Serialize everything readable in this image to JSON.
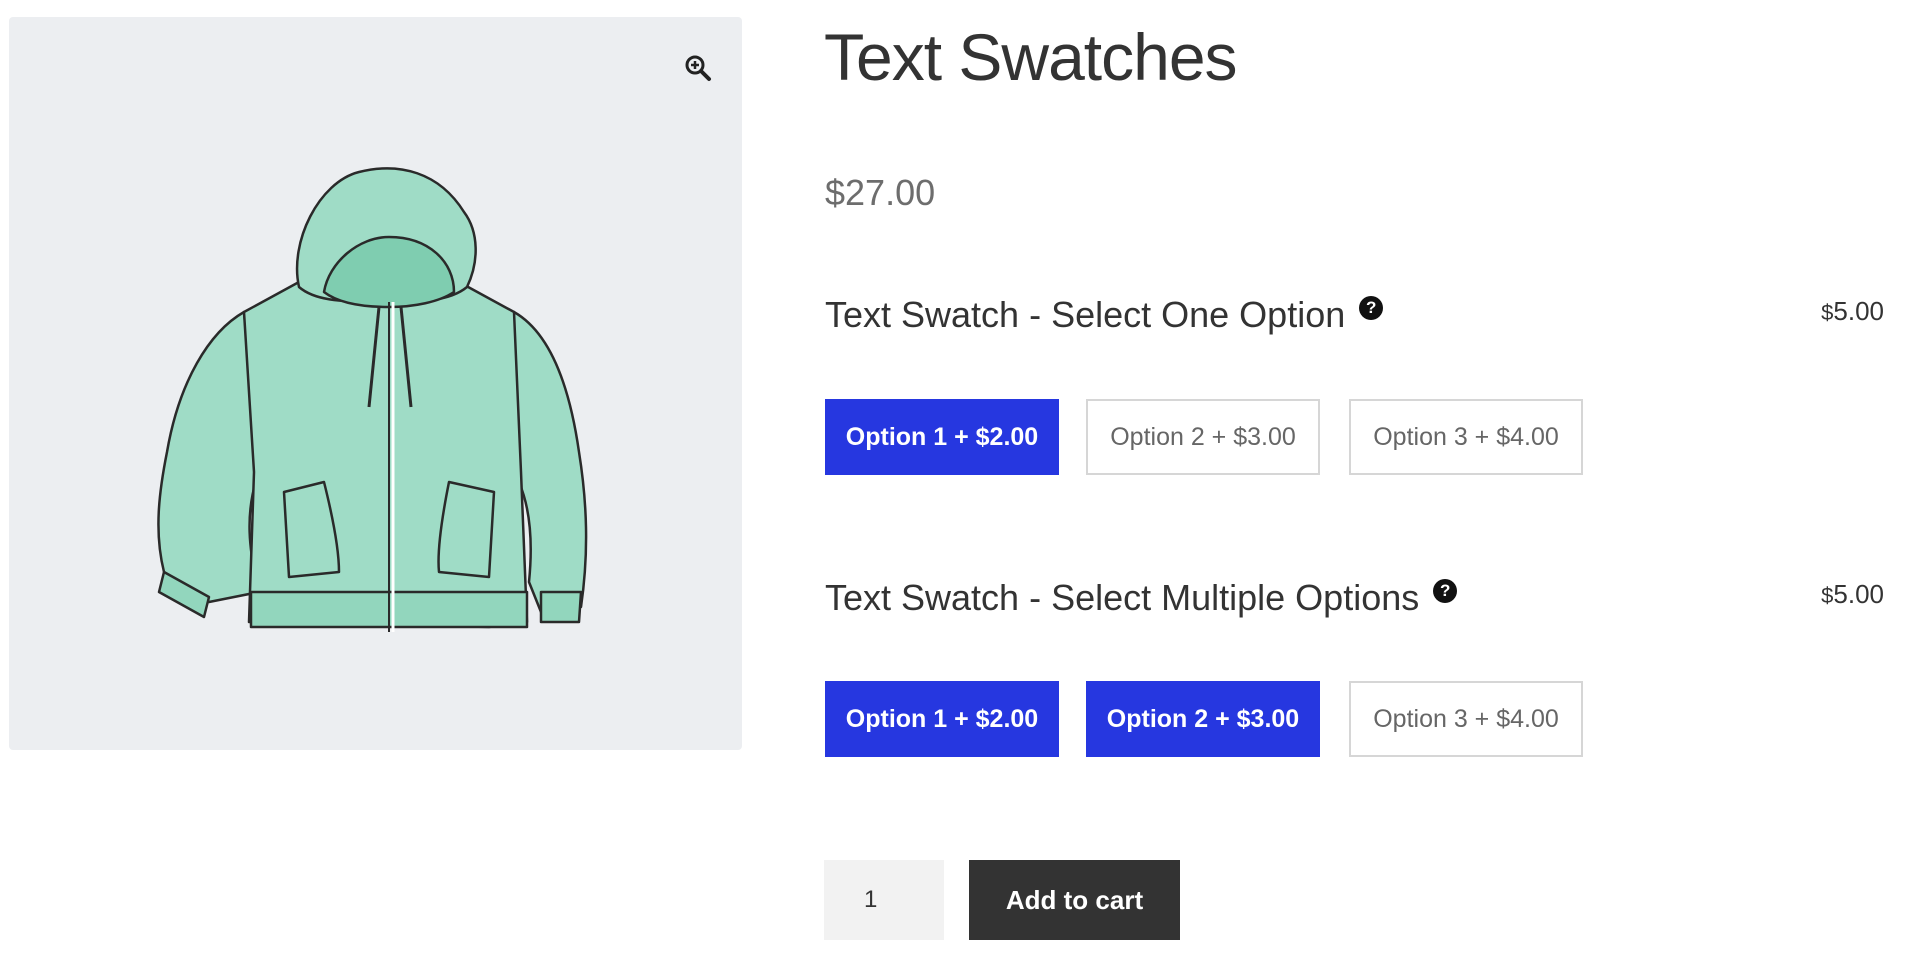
{
  "gallery": {
    "zoom_icon": "zoom-in-icon",
    "image_icon": "hoodie-product-image",
    "colors": {
      "hoodie_fill": "#9fdcc6",
      "background": "#eceef1"
    }
  },
  "product": {
    "title": "Text Swatches",
    "price": "$27.00"
  },
  "groups": [
    {
      "label": "Text Swatch - Select One Option",
      "help_icon": "?",
      "price_currency": "$",
      "price_value": "5.00",
      "options": [
        {
          "label": "Option 1 + $2.00",
          "selected": true
        },
        {
          "label": "Option 2 + $3.00",
          "selected": false
        },
        {
          "label": "Option 3 + $4.00",
          "selected": false
        }
      ]
    },
    {
      "label": "Text Swatch - Select Multiple Options",
      "help_icon": "?",
      "price_currency": "$",
      "price_value": "5.00",
      "options": [
        {
          "label": "Option 1 + $2.00",
          "selected": true
        },
        {
          "label": "Option 2 + $3.00",
          "selected": true
        },
        {
          "label": "Option 3 + $4.00",
          "selected": false
        }
      ]
    }
  ],
  "cart": {
    "quantity": "1",
    "add_label": "Add to cart"
  },
  "colors": {
    "accent": "#2637e0",
    "button_dark": "#333333"
  }
}
